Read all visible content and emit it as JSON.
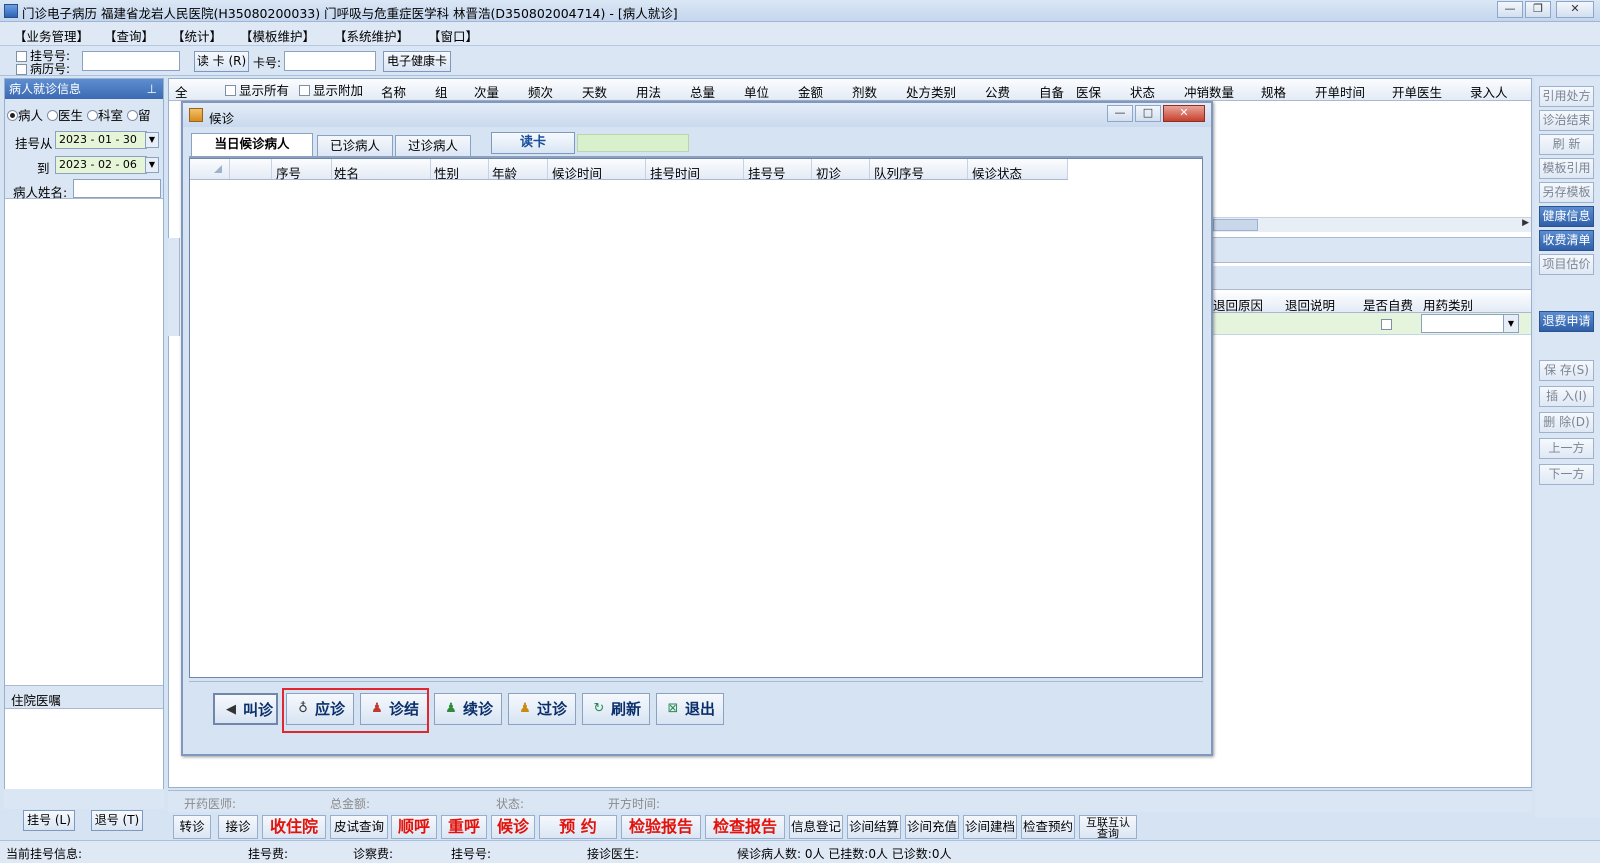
{
  "window": {
    "title": "门诊电子病历  福建省龙岩人民医院(H35080200033)  门呼吸与危重症医学科  林晋浩(D350802004714) - [病人就诊]"
  },
  "menu": [
    "【业务管理】",
    "【查询】",
    "【统计】",
    "【模板维护】",
    "【系统维护】",
    "【窗口】"
  ],
  "toolbar": {
    "reg_no_label": "挂号号:",
    "record_no_label": "病历号:",
    "read_card": "读 卡 (R)",
    "card_no_label": "卡号:",
    "health_card": "电子健康卡"
  },
  "left_panel": {
    "header": "病人就诊信息",
    "pin": "ᚹ",
    "radios": [
      "病人",
      "医生",
      "科室",
      "留"
    ],
    "date_from_label": "挂号从",
    "date_from": "2023 - 01 - 30",
    "date_to_label": "到",
    "date_to": "2023 - 02 - 06",
    "patient_name_label": "病人姓名:",
    "inpatient_orders": "住院医嘱",
    "register_btn": "挂号 (L)",
    "unregister_btn": "退号 (T)"
  },
  "main_grid": {
    "all": "全",
    "show_all": "显示所有",
    "show_extra": "显示附加",
    "columns": [
      "名称",
      "组",
      "次量",
      "频次",
      "天数",
      "用法",
      "总量",
      "单位",
      "金额",
      "剂数",
      "处方类别",
      "公费",
      "自备",
      "医保",
      "状态",
      "冲销数量",
      "规格",
      "开单时间",
      "开单医生",
      "录入人"
    ]
  },
  "refund_grid": {
    "columns": [
      "退回原因",
      "退回说明",
      "是否自费",
      "用药类别"
    ]
  },
  "right_panel": {
    "buttons": [
      "引用处方",
      "诊治结束",
      "刷  新",
      "模板引用",
      "另存模板",
      "健康信息",
      "收费清单",
      "项目估价"
    ],
    "refund_request": "退费申请",
    "edit_buttons": [
      "保 存(S)",
      "插 入(I)",
      "删 除(D)",
      "上一方",
      "下一方"
    ]
  },
  "dialog": {
    "title": "候诊",
    "tabs": [
      "当日候诊病人",
      "已诊病人",
      "过诊病人"
    ],
    "read_card": "读卡",
    "columns": [
      "序号",
      "姓名",
      "性别",
      "年龄",
      "候诊时间",
      "挂号时间",
      "挂号号",
      "初诊",
      "队列序号",
      "候诊状态"
    ],
    "actions": [
      "叫诊",
      "应诊",
      "诊结",
      "续诊",
      "过诊",
      "刷新",
      "退出"
    ]
  },
  "footer_info": {
    "doctor": "开药医师:",
    "total": "总金额:",
    "status": "状态:",
    "time": "开方时间:"
  },
  "bottom_buttons": {
    "small": [
      "转诊",
      "接诊"
    ],
    "red": [
      "收住院",
      "顺呼",
      "重呼",
      "候诊",
      "预  约",
      "检验报告",
      "检查报告"
    ],
    "skin_test": "皮试查询",
    "others": [
      "信息登记",
      "诊间结算",
      "诊间充值",
      "诊间建档",
      "检查预约"
    ],
    "internet": "互联互认\n查询"
  },
  "status_bar": {
    "reg_info": "当前挂号信息:",
    "reg_fee": "挂号费:",
    "consult_fee": "诊察费:",
    "reg_no": "挂号号:",
    "doctor": "接诊医生:",
    "counts": "候诊病人数: 0人  已挂数:0人  已诊数:0人"
  },
  "colors": {
    "highlight_box": "#e0262e",
    "red_button_text": "#e3120b",
    "panel_header": "#3b6ab2"
  }
}
